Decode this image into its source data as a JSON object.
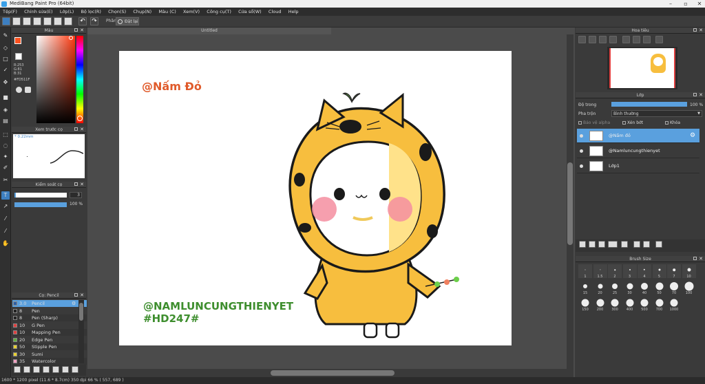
{
  "window": {
    "title": "MediBang Paint Pro (64bit)"
  },
  "menu": [
    "Tệp(F)",
    "Chỉnh sửa(E)",
    "Lớp(L)",
    "Bộ lọc(R)",
    "Chọn(S)",
    "Chụp(N)",
    "Màu (C)",
    "Xem(V)",
    "Công cụ(T)",
    "Cửa sổ(W)",
    "Cloud",
    "Help"
  ],
  "toolbar": {
    "label_phan": "Phân",
    "label_datlai": "Đặt lại"
  },
  "color_panel": {
    "title": "Màu",
    "r": "R:253",
    "g": "G:81",
    "b": "B:31",
    "hex": "#FD511F",
    "fg": "#fd511f",
    "bg": "#ffffff"
  },
  "brush_preview": {
    "title": "Xem trước cọ",
    "size": "0.22mm"
  },
  "brush_control": {
    "title": "Kiểm soát cọ",
    "size_value": "3",
    "opacity_value": "100 %",
    "opacity_fraction": 1.0,
    "size_fraction": 0.03
  },
  "brush_list": {
    "title": "Cọ: Pencil",
    "items": [
      {
        "size": "3.0",
        "name": "Pencil",
        "color": "#2a5fa8",
        "selected": true
      },
      {
        "size": "8",
        "name": "Pen",
        "color": "#222222"
      },
      {
        "size": "8",
        "name": "Pen (Sharp)",
        "color": "#222222"
      },
      {
        "size": "10",
        "name": "G Pen",
        "color": "#e04040"
      },
      {
        "size": "10",
        "name": "Mapping Pen",
        "color": "#e04040"
      },
      {
        "size": "20",
        "name": "Edge Pen",
        "color": "#60b040"
      },
      {
        "size": "50",
        "name": "Stipple Pen",
        "color": "#e8d030"
      },
      {
        "size": "30",
        "name": "Sumi",
        "color": "#e8d030"
      },
      {
        "size": "35",
        "name": "Watercolor",
        "color": "#f0a0c0"
      }
    ]
  },
  "document": {
    "tab_title": "Untitled"
  },
  "artwork": {
    "top_text": "@Nấm Đỏ",
    "bottom_line1": "@NAMLUNCUNGTHIENYET",
    "bottom_line2": "#HD247#",
    "top_text_color": "#e05a2a",
    "bottom_text_color": "#3e8e2e"
  },
  "navigator": {
    "title": "Hoa tiêu"
  },
  "layer_panel": {
    "title": "Lớp",
    "opacity_label": "Độ trong",
    "opacity_value": "100 %",
    "opacity_fraction": 1.0,
    "blend_label": "Pha trộn",
    "blend_value": "Bình thường",
    "protect_alpha": "Bảo vệ alpha",
    "clipping": "Xén bớt",
    "lock": "Khóa",
    "layers": [
      {
        "name": "@Nấm đỏ",
        "selected": true
      },
      {
        "name": "@Namluncungthienyet",
        "selected": false
      },
      {
        "name": "Lớp1",
        "selected": false
      }
    ]
  },
  "brush_size": {
    "title": "Brush Size",
    "sizes": [
      "1",
      "1.5",
      "2",
      "3",
      "4",
      "5",
      "7",
      "10",
      "15",
      "20",
      "25",
      "30",
      "40",
      "50",
      "70",
      "100",
      "150",
      "200",
      "300",
      "400",
      "500",
      "700",
      "1000"
    ]
  },
  "status": {
    "text": "1600 * 1200 pixel   (11.6 * 8.7cm)   350 dpi   66 %   ( 557, 689 )"
  }
}
